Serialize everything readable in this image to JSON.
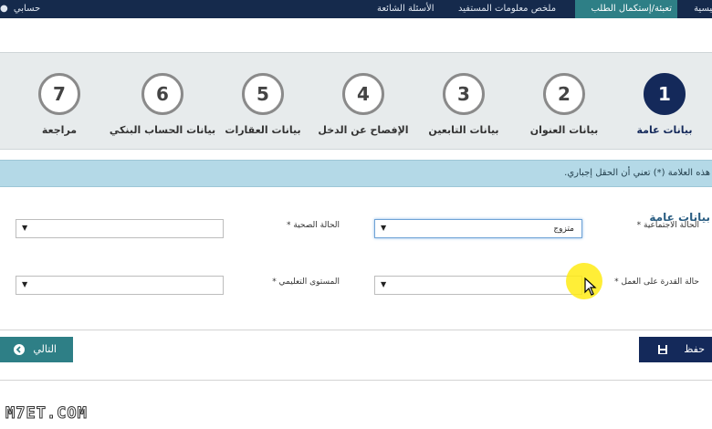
{
  "topbar": {
    "nav": [
      {
        "label": "الأسئلة الشائعة"
      },
      {
        "label": "ملخص معلومات المستفيد"
      },
      {
        "label": "تعبئة/إستكمال الطلب"
      },
      {
        "label": "رئيسية"
      }
    ],
    "account_label": "حسابي"
  },
  "steps": [
    {
      "number": "1",
      "label": "بيانات عامة"
    },
    {
      "number": "2",
      "label": "بيانات العنوان"
    },
    {
      "number": "3",
      "label": "بيانات التابعين"
    },
    {
      "number": "4",
      "label": "الإفصاح عن الدخل"
    },
    {
      "number": "5",
      "label": "بيانات العقارات"
    },
    {
      "number": "6",
      "label": "بيانات الحساب البنكي"
    },
    {
      "number": "7",
      "label": "مراجعة"
    }
  ],
  "notice": "هذه العلامة (*) تعني أن الحقل إجباري.",
  "form": {
    "section_title": "بيانات عامة",
    "marital_status": {
      "label": "الحالة الاجتماعية *",
      "value": "متزوج"
    },
    "health_status": {
      "label": "الحالة الصحية *",
      "value": ""
    },
    "work_ability": {
      "label": "حالة القدرة على العمل *",
      "value": ""
    },
    "education_level": {
      "label": "المستوى التعليمي *",
      "value": ""
    }
  },
  "buttons": {
    "save": "حفظ",
    "next": "التالي"
  },
  "watermark": "M7ET.COM",
  "colors": {
    "primary": "#14295a",
    "accent": "#2e7f86",
    "notice_bg": "#b4d9e7"
  }
}
